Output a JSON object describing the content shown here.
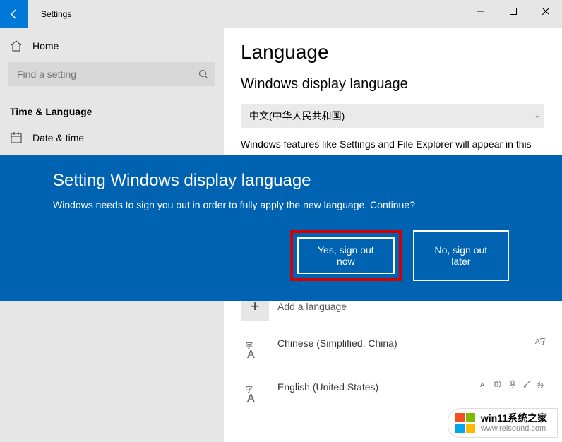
{
  "titlebar": {
    "title": "Settings"
  },
  "sidebar": {
    "home": "Home",
    "search_placeholder": "Find a setting",
    "category": "Time & Language",
    "items": [
      {
        "label": "Date & time"
      }
    ]
  },
  "main": {
    "heading": "Language",
    "section_title": "Windows display language",
    "selected_language": "中文(中华人民共和国)",
    "description": "Windows features like Settings and File Explorer will appear in this language.",
    "add_language_label": "Add a language",
    "languages": [
      {
        "name": "Chinese (Simplified, China)"
      },
      {
        "name": "English (United States)"
      }
    ]
  },
  "dialog": {
    "title": "Setting Windows display language",
    "message": "Windows needs to sign you out in order to fully apply the new language. Continue?",
    "yes": "Yes, sign out now",
    "no": "No, sign out later"
  },
  "watermark": {
    "line1": "win11系统之家",
    "line2": "www.relsound.com"
  }
}
